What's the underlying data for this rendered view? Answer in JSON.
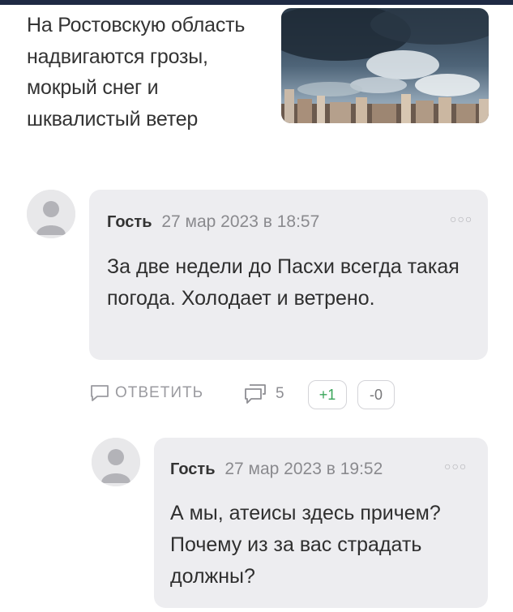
{
  "article": {
    "title": "На Ростовскую область надвигаются грозы, мокрый снег и шквалистый ветер",
    "thumbnail_icon": "storm-clouds-city-image"
  },
  "comments": [
    {
      "author": "Гость",
      "date": "27 мар 2023 в 18:57",
      "more_icon": "more-dots-icon",
      "text": "За две недели до Пасхи всегда такая погода. Холодает и ветрено.",
      "actions": {
        "reply_label": "ОТВЕТИТЬ",
        "replies_count": "5",
        "upvote_label": "+1",
        "downvote_label": "-0"
      }
    },
    {
      "author": "Гость",
      "date": "27 мар 2023 в 19:52",
      "more_icon": "more-dots-icon",
      "text": "А мы, атеисы здесь причем? Почему из за вас страдать должны?"
    }
  ],
  "colors": {
    "bubble": "#ededf0",
    "upvote": "#3aa55a",
    "muted": "#8a8a8e"
  }
}
